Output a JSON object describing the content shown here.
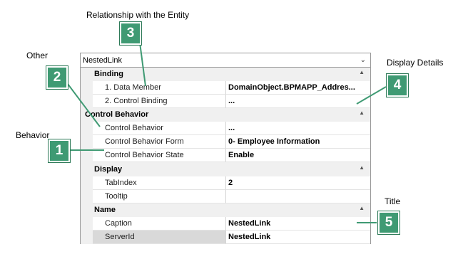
{
  "annotations": {
    "relationship_label": "Relationship with the Entity",
    "other_label": "Other",
    "behavior_label": "Behavior",
    "display_details_label": "Display Details",
    "title_label": "Title",
    "badges": [
      "1",
      "2",
      "3",
      "4",
      "5"
    ]
  },
  "combo": {
    "selected": "NestedLink",
    "arrow_icon": "chevron-down-icon"
  },
  "categories": [
    {
      "label": "Binding",
      "properties": [
        {
          "name": "1. Data Member",
          "value": "DomainObject.BPMAPP_Addres..."
        },
        {
          "name": "2. Control Binding",
          "value": "..."
        }
      ]
    },
    {
      "label": "Control Behavior",
      "properties": [
        {
          "name": "Control Behavior",
          "value": "..."
        },
        {
          "name": "Control Behavior Form",
          "value": "0- Employee Information"
        },
        {
          "name": "Control Behavior State",
          "value": "Enable"
        }
      ]
    },
    {
      "label": "Display",
      "properties": [
        {
          "name": "TabIndex",
          "value": "2"
        },
        {
          "name": "Tooltip",
          "value": ""
        }
      ]
    },
    {
      "label": "Name",
      "properties": [
        {
          "name": "Caption",
          "value": "NestedLink"
        },
        {
          "name": "ServerId",
          "value": "NestedLink"
        }
      ]
    }
  ],
  "colors": {
    "badge": "#3f9a73",
    "grid_bg": "#f0f0f0",
    "selected_row": "#d9d9d9"
  }
}
